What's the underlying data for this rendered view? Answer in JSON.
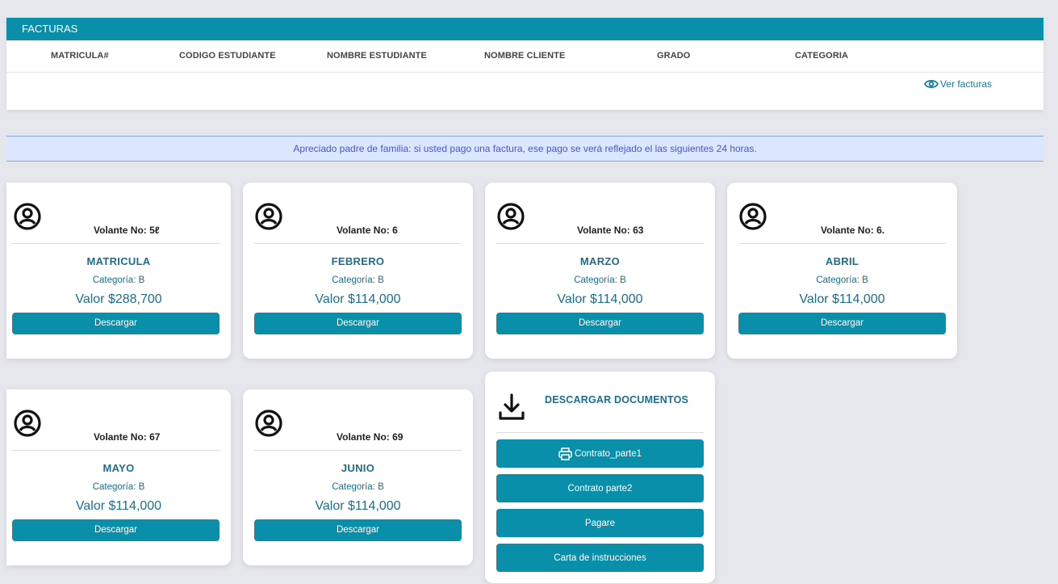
{
  "facturas": {
    "title": "FACTURAS",
    "columns": [
      "MATRICULA#",
      "CODIGO ESTUDIANTE",
      "NOMBRE ESTUDIANTE",
      "NOMBRE CLIENTE",
      "GRADO",
      "CATEGORIA"
    ],
    "ver_label": "Ver facturas"
  },
  "notice": "Apreciado padre de familia: si usted pago una factura, ese pago se verá reflejado el las siguientes 24 horas.",
  "cards": [
    {
      "volante": "Volante No: 5ℓ",
      "mes": "MATRICULA",
      "categoria": "Categoría: B",
      "valor": "Valor $288,700",
      "button": "Descargar"
    },
    {
      "volante": "Volante No: 6",
      "mes": "FEBRERO",
      "categoria": "Categoría: B",
      "valor": "Valor $114,000",
      "button": "Descargar"
    },
    {
      "volante": "Volante No: 63",
      "mes": "MARZO",
      "categoria": "Categoría: B",
      "valor": "Valor $114,000",
      "button": "Descargar"
    },
    {
      "volante": "Volante No: 6.",
      "mes": "ABRIL",
      "categoria": "Categoría: B",
      "valor": "Valor $114,000",
      "button": "Descargar"
    },
    {
      "volante": "Volante No: 67",
      "mes": "MAYO",
      "categoria": "Categoría: B",
      "valor": "Valor $114,000",
      "button": "Descargar"
    },
    {
      "volante": "Volante No: 69",
      "mes": "JUNIO",
      "categoria": "Categoría: B",
      "valor": "Valor $114,000",
      "button": "Descargar"
    }
  ],
  "documentos": {
    "title": "DESCARGAR DOCUMENTOS",
    "buttons": [
      "Contrato_parte1",
      "Contrato parte2",
      "Pagare",
      "Carta de instrucciones"
    ]
  },
  "colors": {
    "accent": "#0a8fab",
    "text_accent": "#1b6f8c",
    "notice_bg": "#dbe7ff",
    "notice_text": "#4a57c9"
  }
}
